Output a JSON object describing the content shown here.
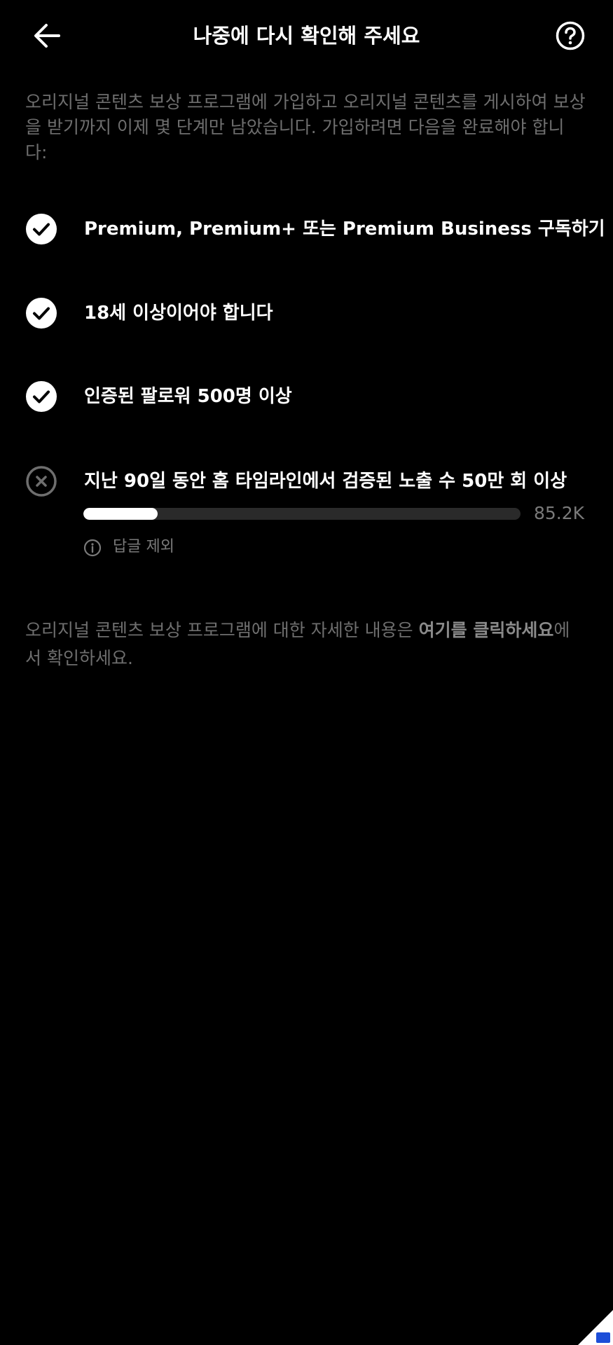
{
  "header": {
    "title": "나중에 다시 확인해 주세요",
    "back_icon": "arrow-left-icon",
    "help_icon": "question-circle-icon"
  },
  "intro": "오리지널 콘텐츠 보상 프로그램에 가입하고 오리지널 콘텐츠를 게시하여 보상을 받기까지 이제 몇 단계만 남았습니다. 가입하려면 다음을 완료해야 합니다:",
  "requirements": [
    {
      "label": "Premium, Premium+ 또는 Premium Business 구독하기",
      "status": "complete",
      "icon": "check-circle-icon"
    },
    {
      "label": "18세 이상이어야 합니다",
      "status": "complete",
      "icon": "check-circle-icon"
    },
    {
      "label": "인증된 팔로워 500명 이상",
      "status": "complete",
      "icon": "check-circle-icon"
    },
    {
      "label": "지난 90일 동안 홈 타임라인에서 검증된 노출 수 50만 회 이상",
      "status": "incomplete",
      "icon": "x-circle-icon",
      "progress_value": "85.2K",
      "progress_fraction": 0.17,
      "note": "답글 제외",
      "note_icon": "info-icon"
    }
  ],
  "footer": {
    "prefix": "오리지널 콘텐츠 보상 프로그램에 대한 자세한 내용은 ",
    "link": "여기를 클릭하세요",
    "suffix": "에서 확인하세요."
  },
  "colors": {
    "background": "#000000",
    "primary_text": "#ffffff",
    "secondary_text": "#6e6e6e",
    "progress_track": "#2a2a2a",
    "progress_fill": "#ffffff",
    "corner_badge": "#1d4ed8"
  }
}
